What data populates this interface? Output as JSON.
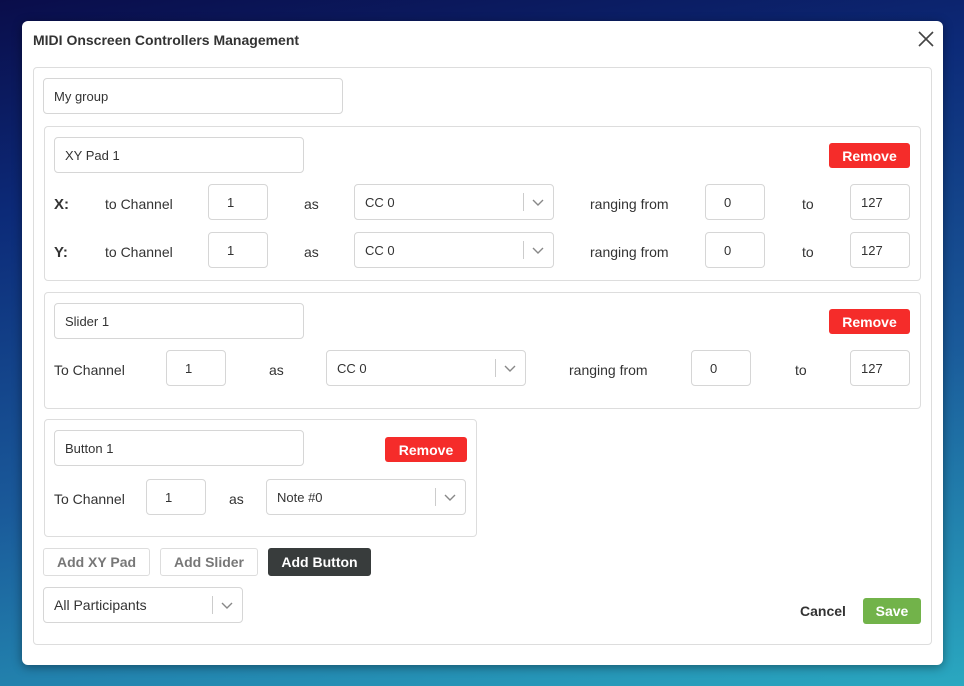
{
  "dialog": {
    "title": "MIDI Onscreen Controllers Management",
    "group_name": "My group"
  },
  "xy_pad": {
    "name": "XY Pad 1",
    "remove": "Remove",
    "rows": [
      {
        "axis": "X:",
        "to_channel": "to Channel",
        "channel": "1",
        "as": "as",
        "message": "CC 0",
        "ranging_from": "ranging from",
        "min": "0",
        "to": "to",
        "max": "127"
      },
      {
        "axis": "Y:",
        "to_channel": "to Channel",
        "channel": "1",
        "as": "as",
        "message": "CC 0",
        "ranging_from": "ranging from",
        "min": "0",
        "to": "to",
        "max": "127"
      }
    ]
  },
  "slider": {
    "name": "Slider 1",
    "remove": "Remove",
    "to_channel": "To Channel",
    "channel": "1",
    "as": "as",
    "message": "CC 0",
    "ranging_from": "ranging from",
    "min": "0",
    "to": "to",
    "max": "127"
  },
  "button": {
    "name": "Button 1",
    "remove": "Remove",
    "to_channel": "To Channel",
    "channel": "1",
    "as": "as",
    "message": "Note #0"
  },
  "add": {
    "xy_pad": "Add XY Pad",
    "slider": "Add Slider",
    "button": "Add Button"
  },
  "participants": "All Participants",
  "footer": {
    "cancel": "Cancel",
    "save": "Save"
  },
  "colors": {
    "remove": "#f52c2a",
    "save": "#72b34a",
    "add_button_active": "#383c3c"
  }
}
